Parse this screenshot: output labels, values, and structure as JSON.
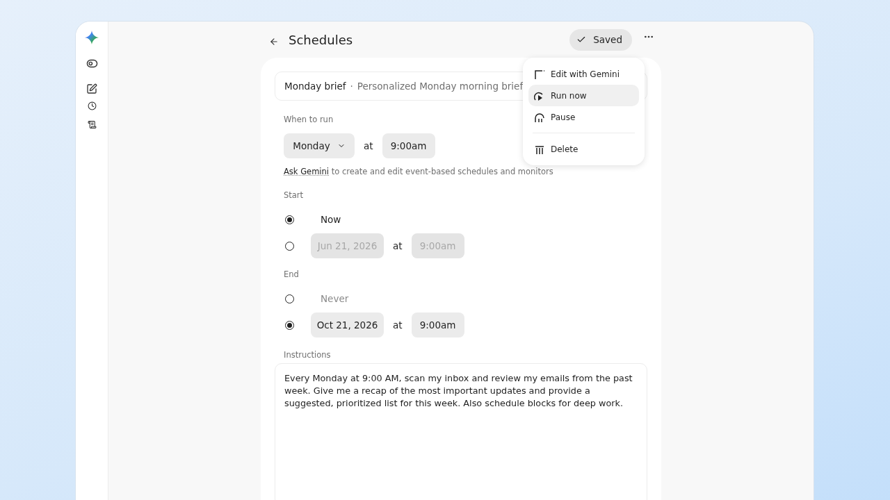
{
  "header": {
    "title": "Schedules",
    "saved_button": "Saved"
  },
  "schedule": {
    "name": "Monday brief",
    "separator": "·",
    "description": "Personalized Monday morning brief"
  },
  "when_to_run": {
    "label": "When to run",
    "day": "Monday",
    "at": "at",
    "time": "9:00am"
  },
  "hint": {
    "link": "Ask Gemini",
    "text": "to create and edit event-based schedules and monitors"
  },
  "start": {
    "label": "Start",
    "options": [
      {
        "kind": "text",
        "label": "Now",
        "selected": true
      },
      {
        "kind": "datetime",
        "date": "Jun 21, 2026",
        "at": "at",
        "time": "9:00am",
        "selected": false
      }
    ]
  },
  "end": {
    "label": "End",
    "options": [
      {
        "kind": "text",
        "label": "Never",
        "selected": false
      },
      {
        "kind": "datetime",
        "date": "Oct 21, 2026",
        "at": "at",
        "time": "9:00am",
        "selected": true
      }
    ]
  },
  "instructions": {
    "label": "Instructions",
    "value": "Every Monday at 9:00 AM, scan my inbox and review my emails from the past week. Give me a recap of the most important updates and provide a suggested, prioritized list for this week. Also schedule blocks for deep work."
  },
  "menu": {
    "groups": [
      [
        {
          "kind": "edit",
          "label": "Edit with Gemini",
          "highlighted": false
        },
        {
          "kind": "run",
          "label": "Run now",
          "highlighted": true
        },
        {
          "kind": "pause",
          "label": "Pause",
          "highlighted": false
        }
      ],
      [
        {
          "kind": "delete",
          "label": "Delete",
          "highlighted": false
        }
      ]
    ]
  }
}
